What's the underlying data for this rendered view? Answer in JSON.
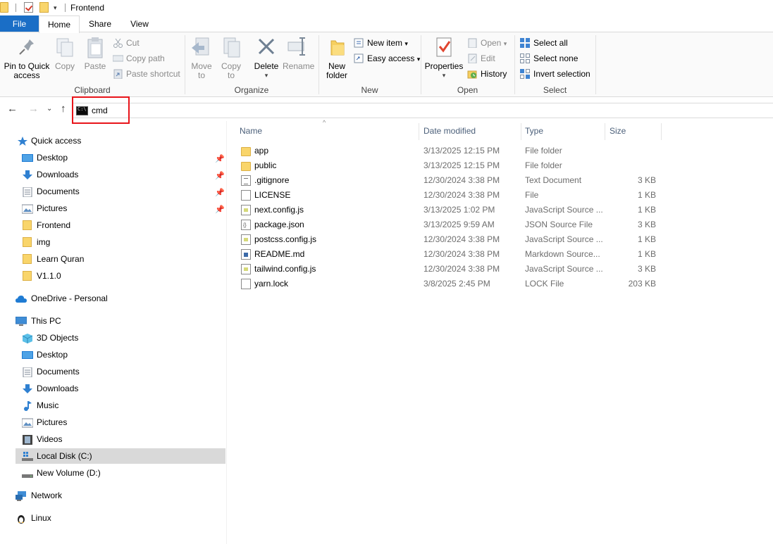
{
  "window": {
    "title": "Frontend"
  },
  "tabs": [
    "File",
    "Home",
    "Share",
    "View"
  ],
  "ribbon": {
    "clipboard": {
      "label": "Clipboard",
      "pin_line1": "Pin to Quick",
      "pin_line2": "access",
      "copy": "Copy",
      "paste": "Paste",
      "cut": "Cut",
      "copy_path": "Copy path",
      "paste_shortcut": "Paste shortcut"
    },
    "organize": {
      "label": "Organize",
      "move_line1": "Move",
      "move_line2": "to",
      "copy_line1": "Copy",
      "copy_line2": "to",
      "delete": "Delete",
      "rename": "Rename"
    },
    "new": {
      "label": "New",
      "folder_line1": "New",
      "folder_line2": "folder",
      "new_item": "New item",
      "easy_access": "Easy access"
    },
    "open": {
      "label": "Open",
      "properties": "Properties",
      "open": "Open",
      "edit": "Edit",
      "history": "History"
    },
    "select": {
      "label": "Select",
      "select_all": "Select all",
      "select_none": "Select none",
      "invert": "Invert selection"
    }
  },
  "address": {
    "text": "cmd"
  },
  "sidebar": {
    "quick_access": "Quick access",
    "quick_items": [
      "Desktop",
      "Downloads",
      "Documents",
      "Pictures",
      "Frontend",
      "img",
      "Learn Quran",
      "V1.1.0"
    ],
    "onedrive": "OneDrive - Personal",
    "this_pc": "This PC",
    "pc_items": [
      "3D Objects",
      "Desktop",
      "Documents",
      "Downloads",
      "Music",
      "Pictures",
      "Videos",
      "Local Disk (C:)",
      "New Volume (D:)"
    ],
    "network": "Network",
    "linux": "Linux"
  },
  "columns": {
    "name": "Name",
    "date": "Date modified",
    "type": "Type",
    "size": "Size"
  },
  "files": [
    {
      "name": "app",
      "date": "3/13/2025 12:15 PM",
      "type": "File folder",
      "size": ""
    },
    {
      "name": "public",
      "date": "3/13/2025 12:15 PM",
      "type": "File folder",
      "size": ""
    },
    {
      "name": ".gitignore",
      "date": "12/30/2024 3:38 PM",
      "type": "Text Document",
      "size": "3 KB"
    },
    {
      "name": "LICENSE",
      "date": "12/30/2024 3:38 PM",
      "type": "File",
      "size": "1 KB"
    },
    {
      "name": "next.config.js",
      "date": "3/13/2025 1:02 PM",
      "type": "JavaScript Source ...",
      "size": "1 KB"
    },
    {
      "name": "package.json",
      "date": "3/13/2025 9:59 AM",
      "type": "JSON Source File",
      "size": "3 KB"
    },
    {
      "name": "postcss.config.js",
      "date": "12/30/2024 3:38 PM",
      "type": "JavaScript Source ...",
      "size": "1 KB"
    },
    {
      "name": "README.md",
      "date": "12/30/2024 3:38 PM",
      "type": "Markdown Source...",
      "size": "1 KB"
    },
    {
      "name": "tailwind.config.js",
      "date": "12/30/2024 3:38 PM",
      "type": "JavaScript Source ...",
      "size": "3 KB"
    },
    {
      "name": "yarn.lock",
      "date": "3/8/2025 2:45 PM",
      "type": "LOCK File",
      "size": "203 KB"
    }
  ]
}
